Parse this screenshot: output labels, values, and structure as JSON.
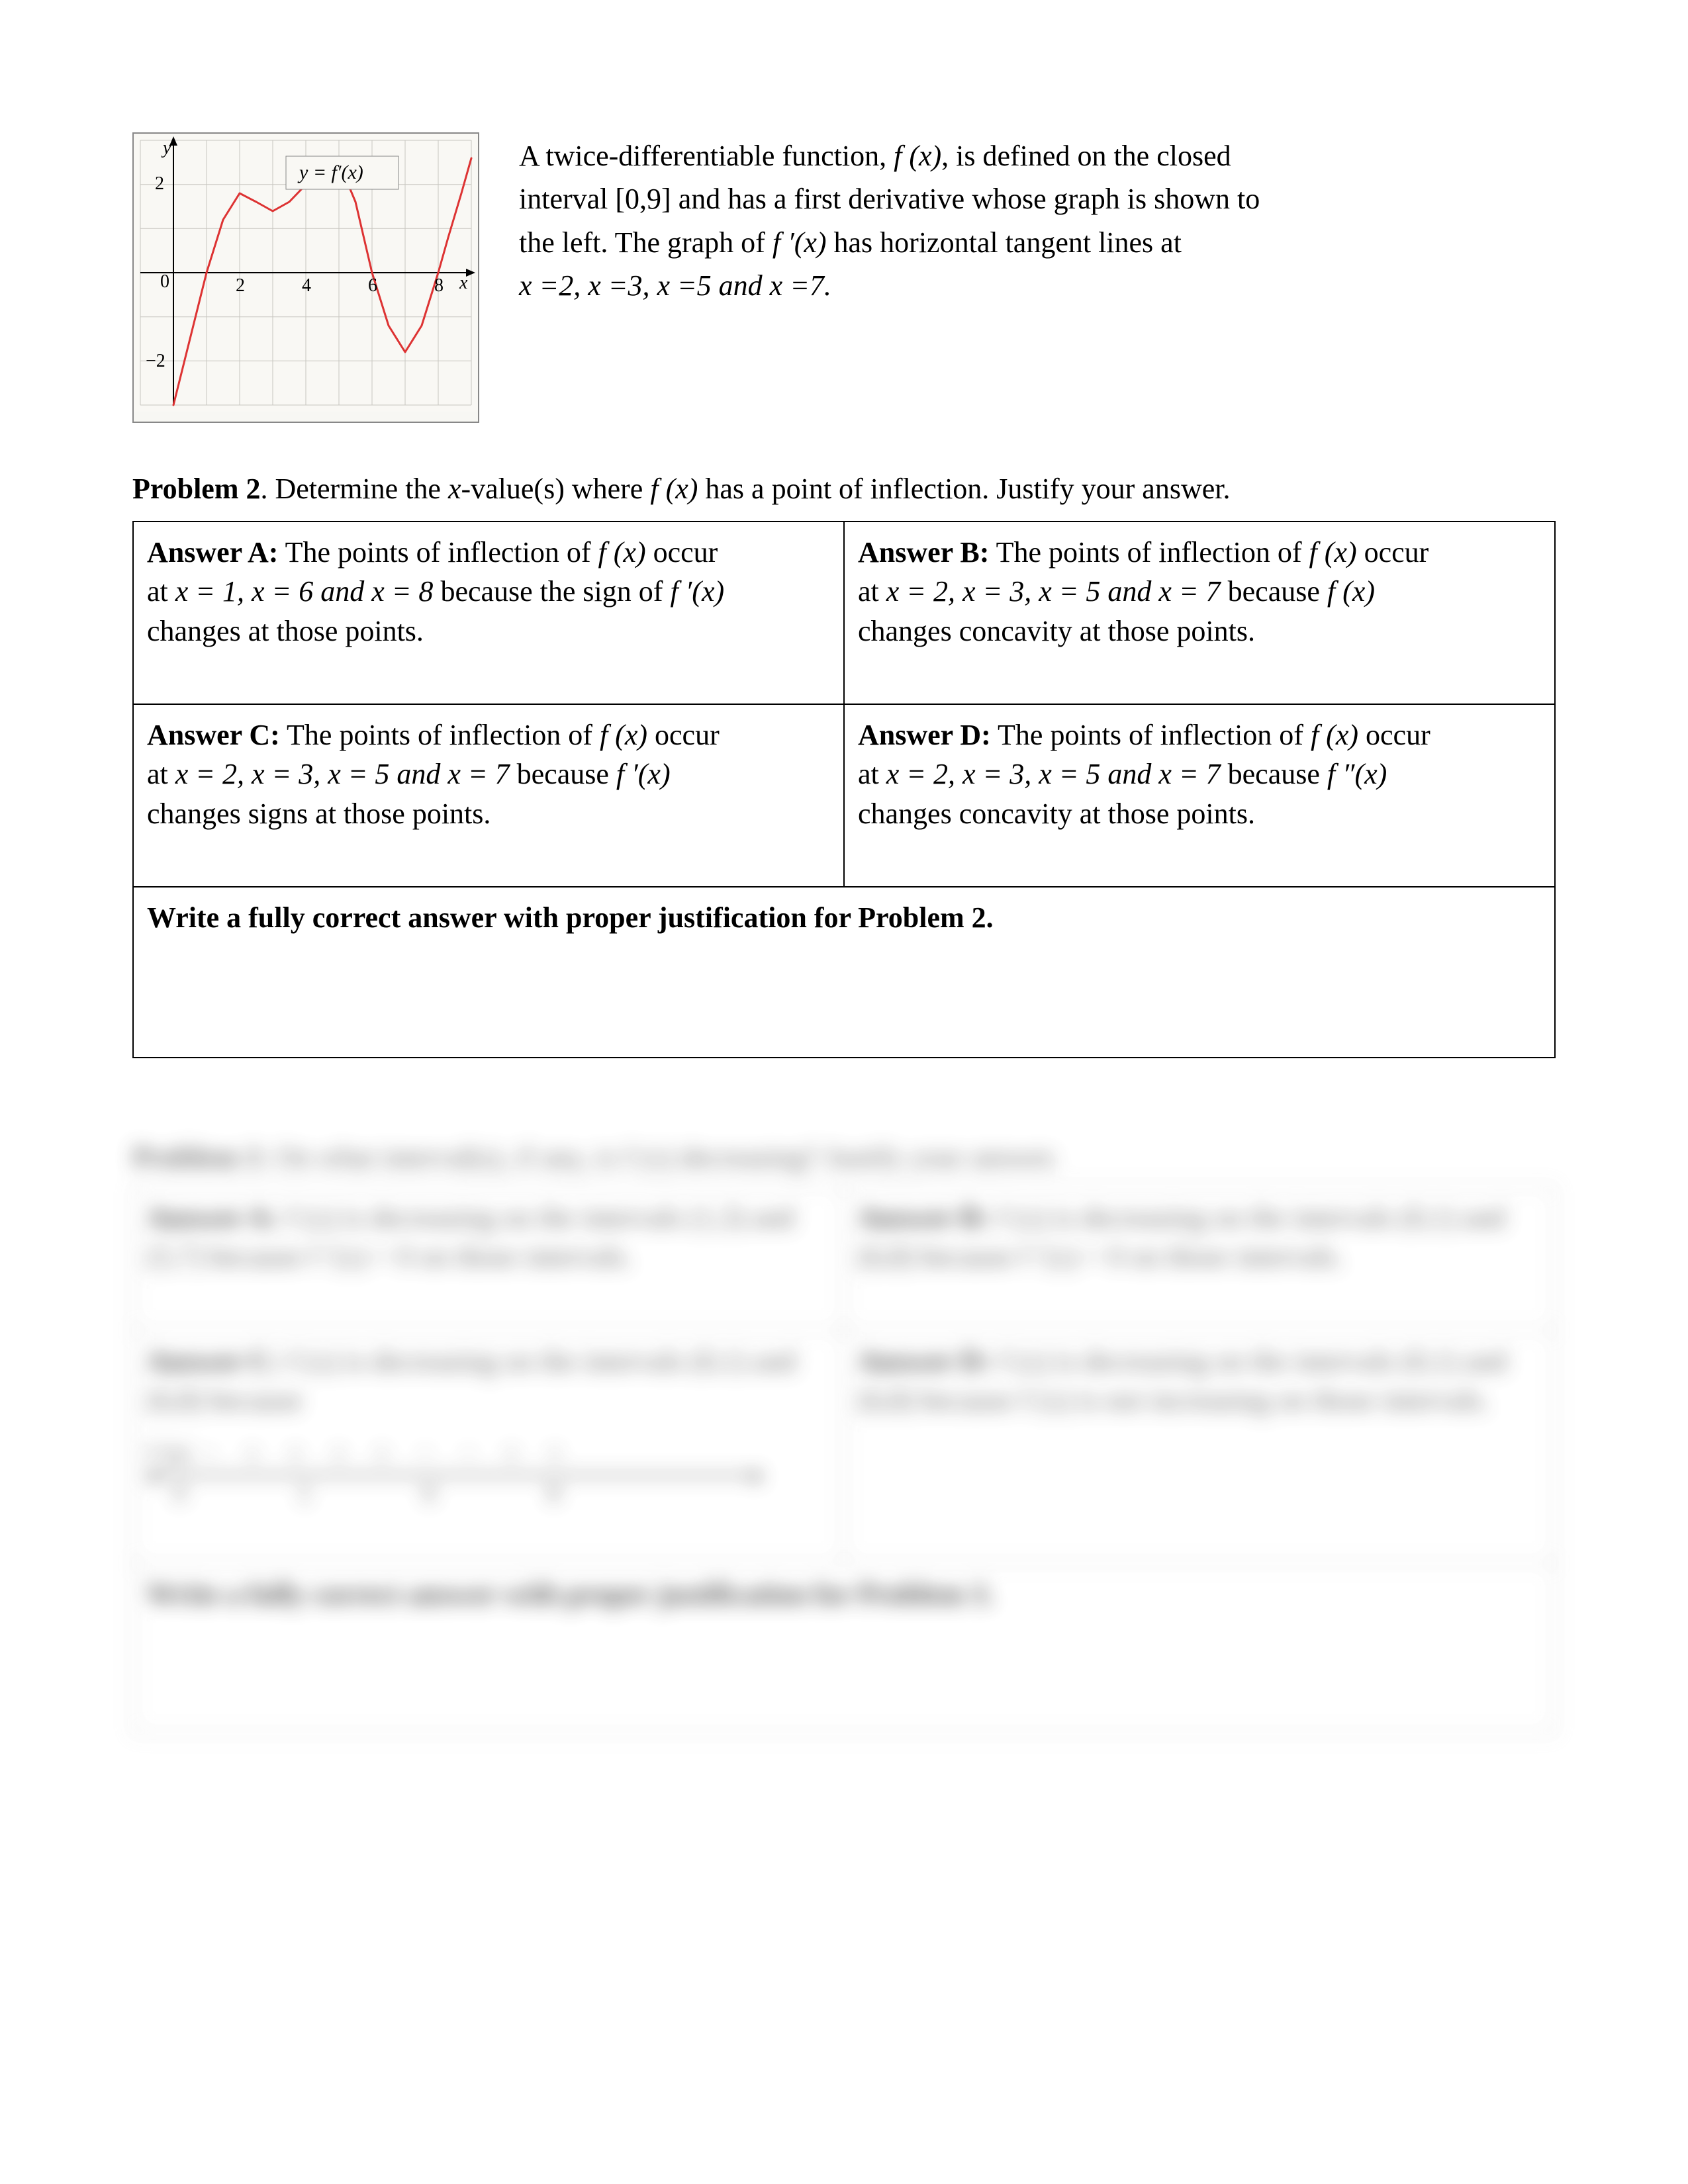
{
  "chart_data": {
    "type": "line",
    "title": "",
    "curve_label": "y = f′(x)",
    "xlabel": "x",
    "ylabel": "y",
    "xlim": [
      -1,
      9
    ],
    "ylim": [
      -3,
      3
    ],
    "xticks": [
      0,
      2,
      4,
      6,
      8
    ],
    "yticks": [
      -2,
      0,
      2
    ],
    "grid": true,
    "series": [
      {
        "name": "f′(x)",
        "x": [
          0.0,
          0.4,
          0.8,
          1.0,
          1.5,
          2.0,
          2.5,
          3.0,
          3.5,
          4.0,
          4.5,
          5.0,
          5.5,
          6.0,
          6.5,
          7.0,
          7.5,
          8.0,
          8.3,
          8.7,
          9.0
        ],
        "y": [
          -3.0,
          -1.8,
          -0.6,
          0.0,
          1.2,
          1.8,
          1.6,
          1.4,
          1.6,
          2.0,
          2.4,
          2.5,
          1.6,
          0.0,
          -1.2,
          -1.8,
          -1.2,
          0.0,
          0.8,
          1.8,
          2.6
        ]
      }
    ],
    "horizontal_tangent_x": [
      2,
      3,
      5,
      7
    ],
    "zeros_x": [
      1,
      6,
      8
    ]
  },
  "intro": {
    "line1_a": "A twice-differentiable function, ",
    "line1_b": ", is defined on the closed",
    "line2": "interval [0,9] and has a first derivative whose graph is shown to",
    "line3_a": "the left.  The graph of ",
    "line3_b": " has horizontal tangent lines at",
    "line4": " x =2,  x =3,  x =5 and x =7."
  },
  "problem2": {
    "label": "Problem 2",
    "text_a": ".  Determine the ",
    "text_b": "-value(s) where ",
    "text_c": " has a point of inflection.   Justify your answer.",
    "answers": {
      "A": {
        "label": "Answer A:",
        "t1": "  The points of inflection of  ",
        "t2": " occur",
        "t3": "at ",
        "t4": " because the sign of  ",
        "t5": "changes at those points.",
        "xs": "x = 1, x = 6 and x = 8"
      },
      "B": {
        "label": "Answer B:",
        "t1": "  The points of inflection of  ",
        "t2": " occur",
        "t3": "at ",
        "t4": " because  ",
        "t5": "changes concavity at those points.",
        "xs": "x = 2, x = 3, x = 5 and x = 7"
      },
      "C": {
        "label": "Answer C:",
        "t1": "  The points of inflection of  ",
        "t2": " occur",
        "t3": "at ",
        "t4": " because  ",
        "t5": "changes signs at those points.",
        "xs": "x = 2, x = 3, x = 5 and x = 7"
      },
      "D": {
        "label": "Answer D:",
        "t1": "  The points of inflection of  ",
        "t2": " occur",
        "t3": "at ",
        "t4": " because  ",
        "t5": "changes concavity at those points.",
        "xs": "x = 2, x = 3, x = 5 and x = 7"
      }
    },
    "write_full": "Write a fully correct answer with proper justification for Problem 2."
  },
  "problem3_blur": {
    "label": "Problem 3",
    "text": ".  On what interval(s), if any, is f (x) decreasing?   Justify your answer.",
    "A": {
      "label": "Answer A:",
      "body": "  f (x) is decreasing on the intervals (1,3) and (5,7) because  f ′(x) < 0  on those intervals."
    },
    "B": {
      "label": "Answer B:",
      "body": "  f (x) is decreasing on the intervals (0,1) and (6,8) because  f ′(x) < 0  on those intervals."
    },
    "C": {
      "label": "Answer C:",
      "body": "  f (x) is decreasing on the intervals (0,1) and (6,8) because",
      "signchart_label": "f ′(x)",
      "signs": "− + + + + − − + +",
      "ticks": "0  1        6  8"
    },
    "D": {
      "label": "Answer D:",
      "body": "  f (x) is decreasing on the intervals (0,1) and (6,8) because f (x) is not increasing on those intervals."
    },
    "write_full": "Write a fully correct answer with proper justification for Problem 3."
  },
  "math": {
    "fx": "f (x)",
    "fpx": "f ′(x)",
    "fppx": "f ″(x)",
    "x": "x"
  }
}
